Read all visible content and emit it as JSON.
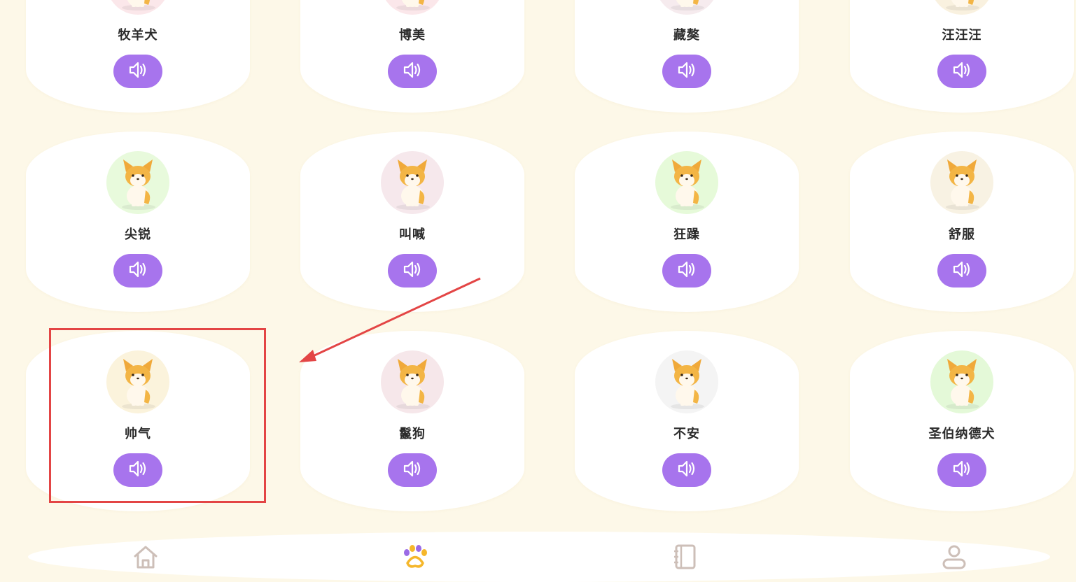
{
  "colors": {
    "background": "#fdf8e8",
    "card": "#ffffff",
    "sound_button": "#a774ed",
    "highlight": "#e34545",
    "tab_active": "#f5b72b",
    "tab_active_accent": "#9b6be6",
    "tab_inactive": "#cdbfb8"
  },
  "rows": [
    {
      "cards": [
        {
          "label": "牧羊犬",
          "avatar_bg": "#fbe7ea",
          "icon": "dog-avatar-icon",
          "button_icon": "speaker-icon"
        },
        {
          "label": "博美",
          "avatar_bg": "#fbe7ea",
          "icon": "dog-avatar-icon",
          "button_icon": "speaker-icon"
        },
        {
          "label": "藏獒",
          "avatar_bg": "#f6ebee",
          "icon": "dog-avatar-icon",
          "button_icon": "speaker-icon"
        },
        {
          "label": "汪汪汪",
          "avatar_bg": "#f9f1df",
          "icon": "dog-avatar-icon",
          "button_icon": "speaker-icon"
        }
      ]
    },
    {
      "cards": [
        {
          "label": "尖锐",
          "avatar_bg": "#e8fadc",
          "icon": "dog-avatar-icon",
          "button_icon": "speaker-icon"
        },
        {
          "label": "叫喊",
          "avatar_bg": "#f6e8ec",
          "icon": "dog-avatar-icon",
          "button_icon": "speaker-icon"
        },
        {
          "label": "狂躁",
          "avatar_bg": "#e6fad9",
          "icon": "dog-avatar-icon",
          "button_icon": "speaker-icon"
        },
        {
          "label": "舒服",
          "avatar_bg": "#f8f2e3",
          "icon": "dog-avatar-icon",
          "button_icon": "speaker-icon"
        }
      ]
    },
    {
      "cards": [
        {
          "label": "帅气",
          "avatar_bg": "#fbf3dc",
          "icon": "dog-avatar-icon",
          "button_icon": "speaker-icon"
        },
        {
          "label": "鬣狗",
          "avatar_bg": "#f6e7ea",
          "icon": "dog-avatar-icon",
          "button_icon": "speaker-icon"
        },
        {
          "label": "不安",
          "avatar_bg": "#f4f4f4",
          "icon": "dog-avatar-icon",
          "button_icon": "speaker-icon"
        },
        {
          "label": "圣伯纳德犬",
          "avatar_bg": "#e4f9d8",
          "icon": "dog-avatar-icon",
          "button_icon": "speaker-icon"
        }
      ]
    }
  ],
  "tabbar": {
    "tabs": [
      {
        "icon": "home-icon",
        "active": false
      },
      {
        "icon": "paw-icon",
        "active": true
      },
      {
        "icon": "notebook-icon",
        "active": false
      },
      {
        "icon": "user-icon",
        "active": false
      }
    ]
  }
}
